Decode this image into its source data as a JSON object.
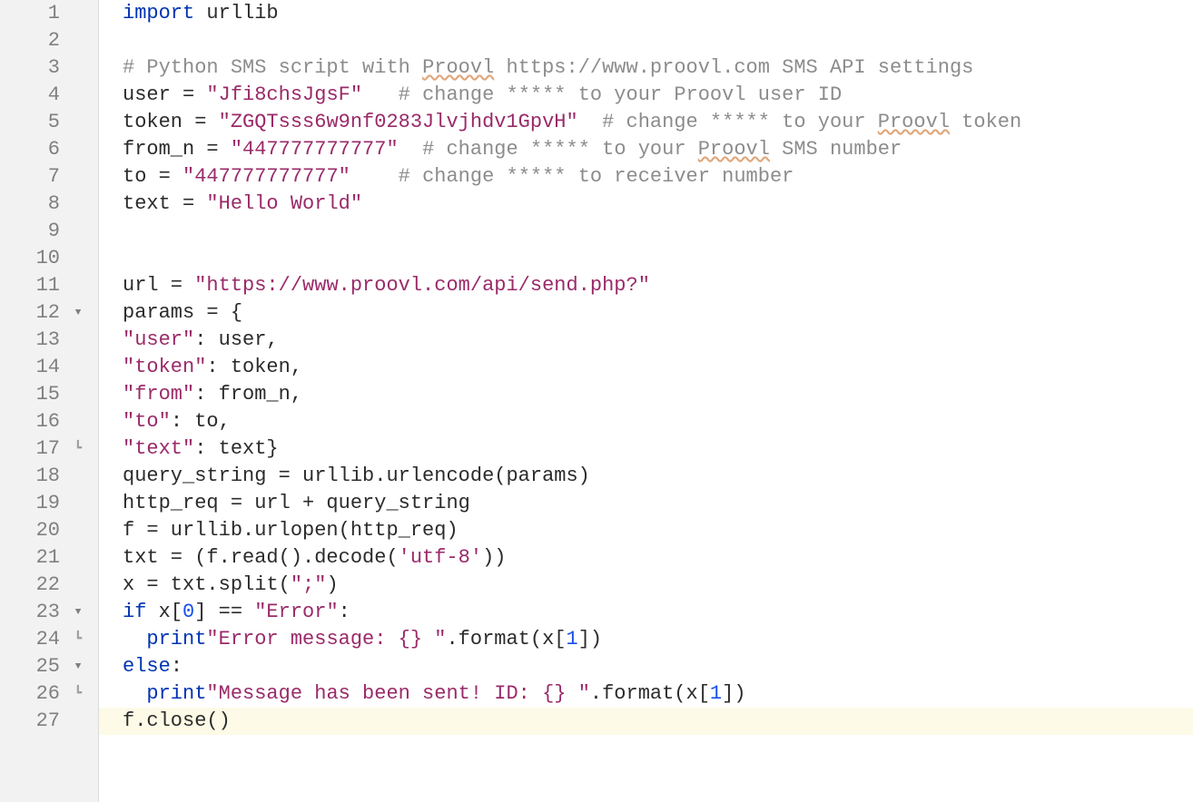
{
  "colors": {
    "keyword": "#0033b3",
    "string": "#9a2a69",
    "number": "#1750eb",
    "comment": "#8c8c8c",
    "squiggle": "#e0a67a",
    "gutter_bg": "#f2f2f2",
    "current_line_bg": "#fdfbe7"
  },
  "current_line": 27,
  "lines": [
    {
      "num": "1",
      "fold": "",
      "tokens": [
        {
          "t": "import ",
          "c": "kw"
        },
        {
          "t": "urllib",
          "c": "ident"
        }
      ]
    },
    {
      "num": "2",
      "fold": "",
      "tokens": []
    },
    {
      "num": "3",
      "fold": "",
      "tokens": [
        {
          "t": "# Python SMS script with ",
          "c": "comment"
        },
        {
          "t": "Proovl",
          "c": "comment squiggle"
        },
        {
          "t": " https://www.proovl.com SMS API settings",
          "c": "comment"
        }
      ]
    },
    {
      "num": "4",
      "fold": "",
      "tokens": [
        {
          "t": "user = ",
          "c": "ident"
        },
        {
          "t": "\"Jfi8chsJgsF\"",
          "c": "str"
        },
        {
          "t": "   ",
          "c": "ident"
        },
        {
          "t": "# change ***** to your Proovl user ID",
          "c": "comment"
        }
      ]
    },
    {
      "num": "5",
      "fold": "",
      "tokens": [
        {
          "t": "token = ",
          "c": "ident"
        },
        {
          "t": "\"ZGQTsss6w9nf0283Jlvjhdv1GpvH\"",
          "c": "str"
        },
        {
          "t": "  ",
          "c": "ident"
        },
        {
          "t": "# change ***** to your ",
          "c": "comment"
        },
        {
          "t": "Proovl",
          "c": "comment squiggle"
        },
        {
          "t": " token",
          "c": "comment"
        }
      ]
    },
    {
      "num": "6",
      "fold": "",
      "tokens": [
        {
          "t": "from_n = ",
          "c": "ident"
        },
        {
          "t": "\"447777777777\"",
          "c": "str"
        },
        {
          "t": "  ",
          "c": "ident"
        },
        {
          "t": "# change ***** to your ",
          "c": "comment"
        },
        {
          "t": "Proovl",
          "c": "comment squiggle"
        },
        {
          "t": " SMS number",
          "c": "comment"
        }
      ]
    },
    {
      "num": "7",
      "fold": "",
      "tokens": [
        {
          "t": "to = ",
          "c": "ident"
        },
        {
          "t": "\"447777777777\"",
          "c": "str"
        },
        {
          "t": "    ",
          "c": "ident"
        },
        {
          "t": "# change ***** to receiver number",
          "c": "comment"
        }
      ]
    },
    {
      "num": "8",
      "fold": "",
      "tokens": [
        {
          "t": "text = ",
          "c": "ident"
        },
        {
          "t": "\"Hello World\"",
          "c": "str"
        }
      ]
    },
    {
      "num": "9",
      "fold": "",
      "tokens": []
    },
    {
      "num": "10",
      "fold": "",
      "tokens": []
    },
    {
      "num": "11",
      "fold": "",
      "tokens": [
        {
          "t": "url = ",
          "c": "ident"
        },
        {
          "t": "\"https://www.proovl.com/api/send.php?\"",
          "c": "str"
        }
      ]
    },
    {
      "num": "12",
      "fold": "down",
      "tokens": [
        {
          "t": "params = {",
          "c": "ident"
        }
      ]
    },
    {
      "num": "13",
      "fold": "",
      "tokens": [
        {
          "t": "\"user\"",
          "c": "str"
        },
        {
          "t": ": user,",
          "c": "ident"
        }
      ]
    },
    {
      "num": "14",
      "fold": "",
      "tokens": [
        {
          "t": "\"token\"",
          "c": "str"
        },
        {
          "t": ": token,",
          "c": "ident"
        }
      ]
    },
    {
      "num": "15",
      "fold": "",
      "tokens": [
        {
          "t": "\"from\"",
          "c": "str"
        },
        {
          "t": ": from_n,",
          "c": "ident"
        }
      ]
    },
    {
      "num": "16",
      "fold": "",
      "tokens": [
        {
          "t": "\"to\"",
          "c": "str"
        },
        {
          "t": ": to,",
          "c": "ident"
        }
      ]
    },
    {
      "num": "17",
      "fold": "end",
      "tokens": [
        {
          "t": "\"text\"",
          "c": "str"
        },
        {
          "t": ": text}",
          "c": "ident"
        }
      ]
    },
    {
      "num": "18",
      "fold": "",
      "tokens": [
        {
          "t": "query_string = urllib.urlencode(params)",
          "c": "ident"
        }
      ]
    },
    {
      "num": "19",
      "fold": "",
      "tokens": [
        {
          "t": "http_req = url + query_string",
          "c": "ident"
        }
      ]
    },
    {
      "num": "20",
      "fold": "",
      "tokens": [
        {
          "t": "f = urllib.urlopen(http_req)",
          "c": "ident"
        }
      ]
    },
    {
      "num": "21",
      "fold": "",
      "tokens": [
        {
          "t": "txt = (f.read().decode(",
          "c": "ident"
        },
        {
          "t": "'utf-8'",
          "c": "str"
        },
        {
          "t": "))",
          "c": "ident"
        }
      ]
    },
    {
      "num": "22",
      "fold": "",
      "tokens": [
        {
          "t": "x = txt.split(",
          "c": "ident"
        },
        {
          "t": "\";\"",
          "c": "str"
        },
        {
          "t": ")",
          "c": "ident"
        }
      ]
    },
    {
      "num": "23",
      "fold": "down",
      "tokens": [
        {
          "t": "if ",
          "c": "kw"
        },
        {
          "t": "x[",
          "c": "ident"
        },
        {
          "t": "0",
          "c": "num"
        },
        {
          "t": "] == ",
          "c": "ident"
        },
        {
          "t": "\"Error\"",
          "c": "str"
        },
        {
          "t": ":",
          "c": "ident"
        }
      ]
    },
    {
      "num": "24",
      "fold": "end",
      "tokens": [
        {
          "t": "  ",
          "c": "ident"
        },
        {
          "t": "print",
          "c": "kw"
        },
        {
          "t": "\"Error message: {} \"",
          "c": "str"
        },
        {
          "t": ".format(x[",
          "c": "ident"
        },
        {
          "t": "1",
          "c": "num"
        },
        {
          "t": "])",
          "c": "ident"
        }
      ]
    },
    {
      "num": "25",
      "fold": "down",
      "tokens": [
        {
          "t": "else",
          "c": "kw"
        },
        {
          "t": ":",
          "c": "ident"
        }
      ]
    },
    {
      "num": "26",
      "fold": "end",
      "tokens": [
        {
          "t": "  ",
          "c": "ident"
        },
        {
          "t": "print",
          "c": "kw"
        },
        {
          "t": "\"Message has been sent! ID: {} \"",
          "c": "str"
        },
        {
          "t": ".format(x[",
          "c": "ident"
        },
        {
          "t": "1",
          "c": "num"
        },
        {
          "t": "])",
          "c": "ident"
        }
      ]
    },
    {
      "num": "27",
      "fold": "",
      "tokens": [
        {
          "t": "f.close()",
          "c": "ident"
        }
      ]
    }
  ],
  "fold_glyphs": {
    "down": "▼",
    "end": "┗"
  }
}
